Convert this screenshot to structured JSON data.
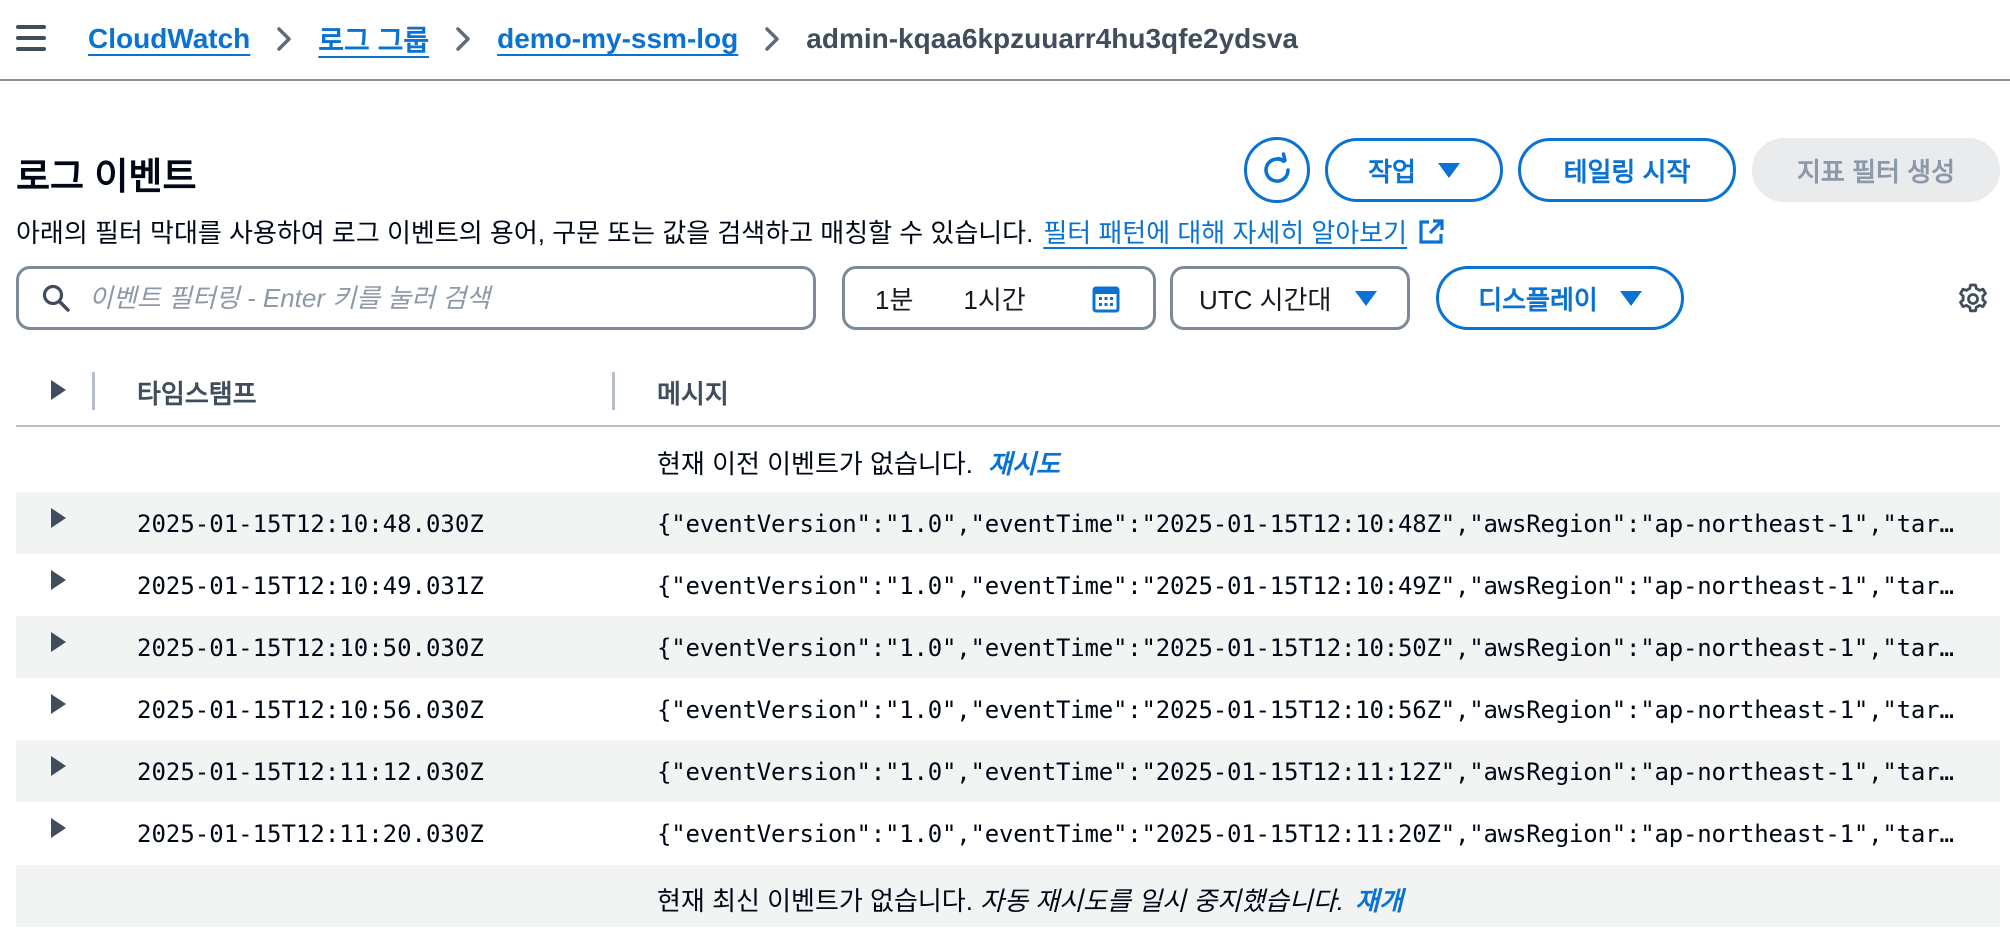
{
  "breadcrumb": {
    "items": [
      "CloudWatch",
      "로그 그룹",
      "demo-my-ssm-log"
    ],
    "current": "admin-kqaa6kpzuuarr4hu3qfe2ydsva"
  },
  "header": {
    "title": "로그 이벤트",
    "description": "아래의 필터 막대를 사용하여 로그 이벤트의 용어, 구문 또는 값을 검색하고 매칭할 수 있습니다.",
    "learn_more_link": "필터 패턴에 대해 자세히 알아보기"
  },
  "buttons": {
    "actions": "작업",
    "start_tailing": "테일링 시작",
    "create_metric_filter": "지표 필터 생성",
    "display": "디스플레이"
  },
  "filter": {
    "search_placeholder": "이벤트 필터링 - Enter 키를 눌러 검색",
    "range_option_1": "1분",
    "range_option_2": "1시간",
    "timezone": "UTC 시간대"
  },
  "table": {
    "columns": [
      "타임스탬프",
      "메시지"
    ],
    "top_notice": {
      "text": "현재 이전 이벤트가 없습니다.",
      "link": "재시도"
    },
    "rows": [
      {
        "timestamp": "2025-01-15T12:10:48.030Z",
        "message": "{\"eventVersion\":\"1.0\",\"eventTime\":\"2025-01-15T12:10:48Z\",\"awsRegion\":\"ap-northeast-1\",\"target\":{}}"
      },
      {
        "timestamp": "2025-01-15T12:10:49.031Z",
        "message": "{\"eventVersion\":\"1.0\",\"eventTime\":\"2025-01-15T12:10:49Z\",\"awsRegion\":\"ap-northeast-1\",\"target\":{}}"
      },
      {
        "timestamp": "2025-01-15T12:10:50.030Z",
        "message": "{\"eventVersion\":\"1.0\",\"eventTime\":\"2025-01-15T12:10:50Z\",\"awsRegion\":\"ap-northeast-1\",\"target\":{}}"
      },
      {
        "timestamp": "2025-01-15T12:10:56.030Z",
        "message": "{\"eventVersion\":\"1.0\",\"eventTime\":\"2025-01-15T12:10:56Z\",\"awsRegion\":\"ap-northeast-1\",\"target\":{}}"
      },
      {
        "timestamp": "2025-01-15T12:11:12.030Z",
        "message": "{\"eventVersion\":\"1.0\",\"eventTime\":\"2025-01-15T12:11:12Z\",\"awsRegion\":\"ap-northeast-1\",\"target\":{}}"
      },
      {
        "timestamp": "2025-01-15T12:11:20.030Z",
        "message": "{\"eventVersion\":\"1.0\",\"eventTime\":\"2025-01-15T12:11:20Z\",\"awsRegion\":\"ap-northeast-1\",\"target\":{}}"
      }
    ],
    "bottom_notice": {
      "text": "현재 최신 이벤트가 없습니다.",
      "italic": "자동 재시도를 일시 중지했습니다.",
      "link": "재개"
    }
  },
  "icons": {
    "menu": "hamburger-icon",
    "separator": "chevron-right-icon",
    "refresh": "refresh-icon",
    "search": "search-icon",
    "calendar": "calendar-icon",
    "settings": "gear-icon",
    "external": "external-link-icon",
    "expand": "caret-right-icon"
  },
  "colors": {
    "link": "#0972d3",
    "text": "#000716",
    "border": "#7d8998",
    "disabled_bg": "#e9ebed",
    "row_alt": "#f2f3f3"
  }
}
